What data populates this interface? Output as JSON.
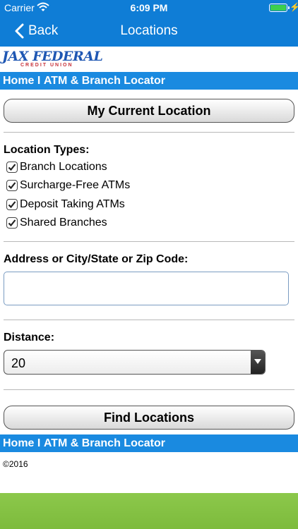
{
  "status_bar": {
    "carrier": "Carrier",
    "time": "6:09 PM",
    "battery_level": 1.0,
    "battery_color": "#3ccf4e"
  },
  "nav": {
    "back_label": "Back",
    "title": "Locations",
    "bar_color": "#0f7dd6"
  },
  "logo": {
    "main": "JAX FEDERAL",
    "sub": "CREDIT UNION"
  },
  "breadcrumb": {
    "home": "Home",
    "separator": "I",
    "current": "ATM & Branch Locator",
    "bar_color": "#1a8ae0"
  },
  "current_location_button": "My Current Location",
  "location_types": {
    "label": "Location Types:",
    "options": [
      {
        "label": "Branch Locations",
        "checked": true
      },
      {
        "label": "Surcharge-Free ATMs",
        "checked": true
      },
      {
        "label": "Deposit Taking ATMs",
        "checked": true
      },
      {
        "label": "Shared Branches",
        "checked": true
      }
    ]
  },
  "address": {
    "label": "Address or City/State or Zip Code:",
    "value": ""
  },
  "distance": {
    "label": "Distance:",
    "selected": "20"
  },
  "find_button": "Find Locations",
  "copyright": "©2016",
  "footer_color": "#8cc84b"
}
